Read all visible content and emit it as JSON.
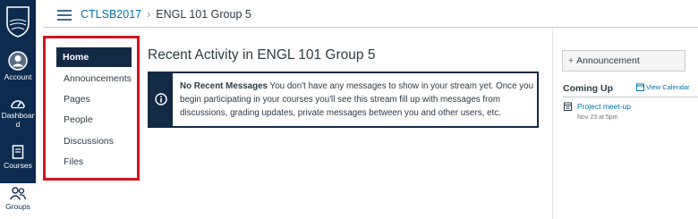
{
  "global_nav": {
    "logo_text": "UBC",
    "items": [
      {
        "label": "Account",
        "icon": "avatar-icon"
      },
      {
        "label": "Dashboar\nd",
        "icon": "speedometer-icon"
      },
      {
        "label": "Courses",
        "icon": "book-icon"
      },
      {
        "label": "Groups",
        "icon": "people-icon"
      }
    ]
  },
  "breadcrumb": {
    "course": "CTLSB2017",
    "separator": "›",
    "current": "ENGL 101 Group 5"
  },
  "course_nav": {
    "items": [
      "Home",
      "Announcements",
      "Pages",
      "People",
      "Discussions",
      "Files"
    ],
    "active": "Home"
  },
  "main": {
    "title": "Recent Activity in ENGL 101 Group 5",
    "alert": {
      "icon": "info-icon",
      "heading": "No Recent Messages",
      "text": " You don't have any messages to show in your stream yet. Once you begin participating in your courses you'll see this stream fill up with messages from discussions, grading updates, private messages between you and other users, etc."
    }
  },
  "sidebar": {
    "announcement_button": "Announcement",
    "coming_up_title": "Coming Up",
    "calendar_link": "View Calendar",
    "events": [
      {
        "title": "Project meet-up",
        "date": "Nov 23 at 5pm",
        "icon": "calendar-icon"
      }
    ]
  },
  "colors": {
    "nav_bg": "#0c2b4e",
    "link": "#0770a3",
    "highlight_border": "#d0161f",
    "active_nav": "#132a45"
  }
}
